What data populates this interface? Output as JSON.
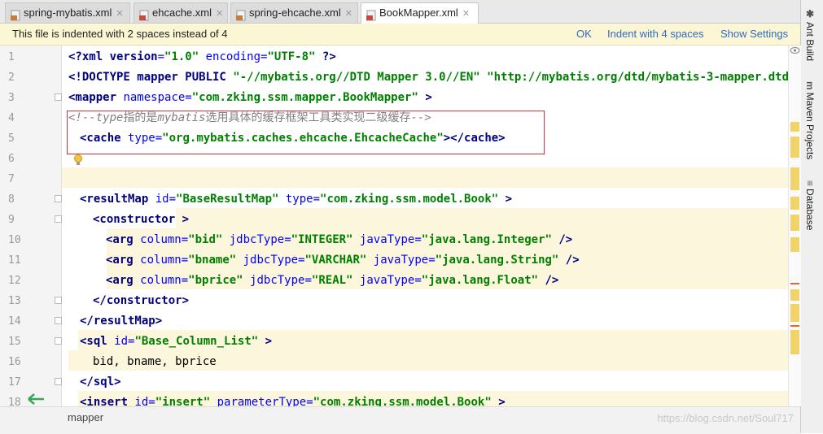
{
  "tabs": [
    {
      "label": "spring-mybatis.xml",
      "active": false
    },
    {
      "label": "ehcache.xml",
      "active": false
    },
    {
      "label": "spring-ehcache.xml",
      "active": false
    },
    {
      "label": "BookMapper.xml",
      "active": true
    }
  ],
  "side_panels": [
    "Ant Build",
    "Maven Projects",
    "Database"
  ],
  "notification": {
    "message": "This file is indented with 2 spaces instead of 4",
    "ok": "OK",
    "indent": "Indent with 4 spaces",
    "settings": "Show Settings"
  },
  "line_numbers": [
    "1",
    "2",
    "3",
    "4",
    "5",
    "6",
    "7",
    "8",
    "9",
    "10",
    "11",
    "12",
    "13",
    "14",
    "15",
    "16",
    "17",
    "18"
  ],
  "code": {
    "l1": [
      "<?",
      "xml version",
      "=",
      "\"1.0\"",
      " encoding",
      "=",
      "\"UTF-8\"",
      " ?>"
    ],
    "l2": [
      "<!DOCTYPE mapper PUBLIC ",
      "\"-//mybatis.org//DTD Mapper 3.0//EN\"",
      " ",
      "\"http://mybatis.org/dtd/mybatis-3-mapper.dtd\""
    ],
    "l3": [
      "<mapper ",
      "namespace",
      "=",
      "\"com.zking.ssm.mapper.BookMapper\"",
      " >"
    ],
    "l4": [
      "<!--",
      "type",
      "指的是",
      "mybatis",
      "选用具体的缓存框架工具类实现二级缓存",
      "-->"
    ],
    "l5": [
      "<cache ",
      "type",
      "=",
      "\"org.mybatis.caches.ehcache.EhcacheCache\"",
      "></cache>"
    ],
    "l8": [
      "<resultMap ",
      "id",
      "=",
      "\"BaseResultMap\"",
      " type",
      "=",
      "\"com.zking.ssm.model.Book\"",
      " >"
    ],
    "l9": [
      "<constructor >"
    ],
    "l10": [
      "<arg ",
      "column",
      "=",
      "\"bid\"",
      " jdbcType",
      "=",
      "\"INTEGER\"",
      " javaType",
      "=",
      "\"java.lang.Integer\"",
      " />"
    ],
    "l11": [
      "<arg ",
      "column",
      "=",
      "\"bname\"",
      " jdbcType",
      "=",
      "\"VARCHAR\"",
      " javaType",
      "=",
      "\"java.lang.String\"",
      " />"
    ],
    "l12": [
      "<arg ",
      "column",
      "=",
      "\"bprice\"",
      " jdbcType",
      "=",
      "\"REAL\"",
      " javaType",
      "=",
      "\"java.lang.Float\"",
      " />"
    ],
    "l13": [
      "</constructor>"
    ],
    "l14": [
      "</resultMap>"
    ],
    "l15": [
      "<sql ",
      "id",
      "=",
      "\"Base_Column_List\"",
      " >"
    ],
    "l16": [
      "bid, bname, bprice"
    ],
    "l17": [
      "</sql>"
    ],
    "l18": [
      "<insert ",
      "id",
      "=",
      "\"insert\"",
      " parameterType",
      "=",
      "\"com.zking.ssm.model.Book\"",
      " >"
    ]
  },
  "breadcrumb": "mapper",
  "watermark": "https://blog.csdn.net/Soul717",
  "colors": {
    "tag": "#000080",
    "attr": "#0000ff",
    "value": "#008000",
    "comment": "#808080",
    "highlight": "#fcf6dc",
    "annotation_box": "#d0323c",
    "back_arrow": "#3aa655"
  },
  "icons": {
    "xml_file": "xml-file-icon",
    "bulb": "lightbulb-icon",
    "arrow": "back-arrow-icon"
  }
}
